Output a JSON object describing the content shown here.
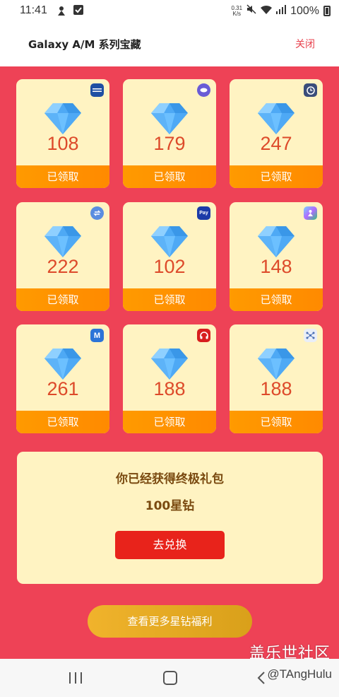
{
  "status_bar": {
    "time": "11:41",
    "netspeed_top": "0.31",
    "netspeed_bottom": "K/s",
    "battery": "100%"
  },
  "header": {
    "title": "Galaxy A/M 系列宝藏",
    "close_label": "关闭"
  },
  "cards": [
    {
      "value": "108",
      "status": "已领取",
      "badge_icon": "samsung-members-icon",
      "badge_color": "#1f4fa3"
    },
    {
      "value": "179",
      "status": "已领取",
      "badge_icon": "galaxy-store-icon",
      "badge_color": "#6a5bd6"
    },
    {
      "value": "247",
      "status": "已领取",
      "badge_icon": "clock-app-icon",
      "badge_color": "#3a4d7a"
    },
    {
      "value": "222",
      "status": "已领取",
      "badge_icon": "smart-switch-icon",
      "badge_color": "#5a8de0"
    },
    {
      "value": "102",
      "status": "已领取",
      "badge_icon": "samsung-pay-icon",
      "badge_color": "#1b3aa8"
    },
    {
      "value": "148",
      "status": "已领取",
      "badge_icon": "game-launcher-icon",
      "badge_color": "#2aa36b"
    },
    {
      "value": "261",
      "status": "已领取",
      "badge_icon": "samsung-notes-icon",
      "badge_color": "#2b74d8"
    },
    {
      "value": "188",
      "status": "已领取",
      "badge_icon": "headphones-app-icon",
      "badge_color": "#d81e1e"
    },
    {
      "value": "188",
      "status": "已领取",
      "badge_icon": "share-network-icon",
      "badge_color": "#e9eef8"
    }
  ],
  "badge_text": {
    "pay": "Pay",
    "m": "M"
  },
  "gift": {
    "title": "你已经获得终极礼包",
    "amount": "100星钻",
    "redeem_label": "去兑换"
  },
  "more_label": "查看更多星钻福利",
  "watermark": {
    "site": "盖乐世社区",
    "user": "@TAngHulu"
  },
  "colors": {
    "background_red": "#ee4256",
    "card_bg": "#fff3c2",
    "footer_orange": "#ff9a00",
    "value_red": "#dd4a2a",
    "redeem_red": "#e8231b",
    "more_gold": "#e0a822"
  }
}
